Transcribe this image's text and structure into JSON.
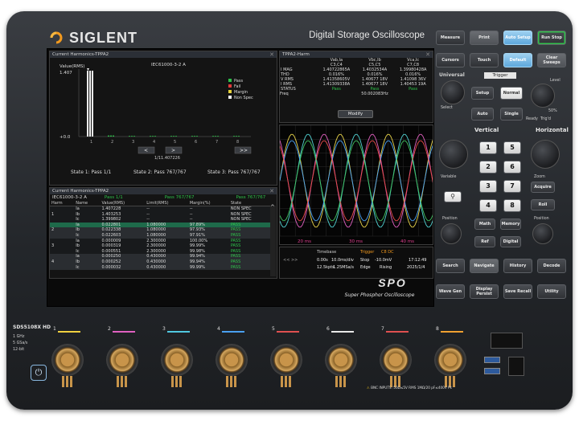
{
  "brand": "SIGLENT",
  "tagline": "Digital Storage Oscilloscope",
  "model": "SDS5108X HD",
  "specs": [
    "1 GHz",
    "5 GSa/s",
    "12-bit"
  ],
  "spo_logo": "SPO",
  "spo_sub": "Super Phosphor Oscilloscope",
  "harm_chart": {
    "title": "Current Harmonics-TPPA2",
    "std": "IEC61000-3-2 A",
    "ylabel": "Value(RMS)",
    "ymax": "1.407",
    "ymin": "+0.0",
    "xticks": [
      "1",
      "2",
      "3",
      "4",
      "5",
      "6",
      "7",
      "8"
    ],
    "legend": [
      "Pass",
      "Fail",
      "Margin",
      "Non Spec"
    ],
    "legend_colors": [
      "#2ec24a",
      "#e23b3b",
      "#e6d23a",
      "#f2f2f2"
    ],
    "cursor_val": "1/11.407226",
    "states": [
      "State 1: Pass 1/1",
      "State 2: Pass 767/767",
      "State 3: Pass 767/767"
    ]
  },
  "harm_table": {
    "title": "Current Harmonics-TPPA2",
    "std": "IEC61000-3-2 A",
    "passes": [
      "Pass 1/1",
      "Pass 767/767",
      "Pass 767/767"
    ],
    "headers": [
      "Harm",
      "Name",
      "Value(RMS)",
      "Limit(RMS)",
      "Margin(%)",
      "State"
    ],
    "rows": [
      [
        "",
        "Ia",
        "1.407228",
        "--",
        "--",
        "NON SPEC"
      ],
      [
        "1",
        "Ib",
        "1.403253",
        "--",
        "--",
        "NON SPEC"
      ],
      [
        "",
        "Ic",
        "1.399802",
        "--",
        "--",
        "NON SPEC"
      ],
      [
        "",
        "Ia",
        "0.022801",
        "1.080000",
        "97.89%",
        "PASS"
      ],
      [
        "2",
        "Ib",
        "0.022338",
        "1.080000",
        "97.93%",
        "PASS"
      ],
      [
        "",
        "Ic",
        "0.022603",
        "1.080000",
        "97.91%",
        "PASS"
      ],
      [
        "",
        "Ia",
        "0.000009",
        "2.300000",
        "100.00%",
        "PASS"
      ],
      [
        "3",
        "Ib",
        "0.000319",
        "2.300000",
        "99.99%",
        "PASS"
      ],
      [
        "",
        "Ic",
        "0.000551",
        "2.300000",
        "99.98%",
        "PASS"
      ],
      [
        "",
        "Ia",
        "0.000250",
        "0.430000",
        "99.94%",
        "PASS"
      ],
      [
        "4",
        "Ib",
        "0.000252",
        "0.430000",
        "99.94%",
        "PASS"
      ],
      [
        "",
        "Ic",
        "0.000032",
        "0.430000",
        "99.99%",
        "PASS"
      ]
    ]
  },
  "meas": {
    "title": "TPPA2-Harm",
    "cols": [
      "Vab,Ia",
      "Vbc,Ib",
      "Vca,Ic"
    ],
    "subcols": [
      "C3,C4",
      "C5,C5",
      "C7,C8"
    ],
    "rows": [
      [
        "I MAG",
        "1.40722865A",
        "1.4032534A",
        "1.39980428A"
      ],
      [
        "THD",
        "0.016%",
        "0.016%",
        "0.016%"
      ],
      [
        "V RMS",
        "1.41358605V",
        "1.40677 18V",
        "1.41098 36V"
      ],
      [
        "I RMS",
        "1.41309338A",
        "1.40677 18V",
        "1.40453 19A"
      ],
      [
        "STATUS",
        "Pass",
        "Pass",
        "Pass"
      ]
    ],
    "freq_label": "Freq",
    "freq": "50.002083Hz",
    "modify": "Modify"
  },
  "wave": {
    "times": [
      "20 ms",
      "30 ms",
      "40 ms"
    ]
  },
  "tbase": {
    "timebase": "Timebase",
    "trigger": "Trigger",
    "trig_ch": "C8 DC",
    "t1": "0.00s",
    "t2": "10.0ms/div",
    "t3": "Stop",
    "t4": "-10.0mV",
    "t5": "17:12:49",
    "t6": "12.5kpts",
    "t7": "1.25MSa/s",
    "t8": "Edge",
    "t9": "Rising",
    "t10": "2025/1/4"
  },
  "buttons": {
    "measure": "Measure",
    "print": "Print",
    "auto_setup": "Auto Setup",
    "run_stop": "Run Stop",
    "cursors": "Cursors",
    "touch": "Touch",
    "default": "Default",
    "clear_sweeps": "Clear Sweeps",
    "universal": "Universal",
    "trigger": "Trigger",
    "level": "Level",
    "setup": "Setup",
    "normal": "Normal",
    "auto": "Auto",
    "single": "Single",
    "select": "Select",
    "fifty": "50%",
    "ready": "Ready",
    "trigd": "Trig'd",
    "vertical": "Vertical",
    "horizontal": "Horizontal",
    "ch": [
      "1",
      "5",
      "2",
      "6",
      "3",
      "7",
      "4",
      "8"
    ],
    "zoom": "Zoom",
    "acquire": "Acquire",
    "roll": "Roll",
    "position": "Position",
    "math": "Math",
    "memory": "Memory",
    "ref": "Ref",
    "digital": "Digital",
    "variable": "Variable",
    "search": "Search",
    "navigate": "Navigate",
    "history": "History",
    "decode": "Decode",
    "wave_gen": "Wave Gen",
    "display_persist": "Display Persist",
    "save_recall": "Save Recall",
    "utility": "Utility"
  },
  "warn": "BNC INPUTS: 50Ω≤5V RMS 1MΩ/20 pF≤400V Pk"
}
